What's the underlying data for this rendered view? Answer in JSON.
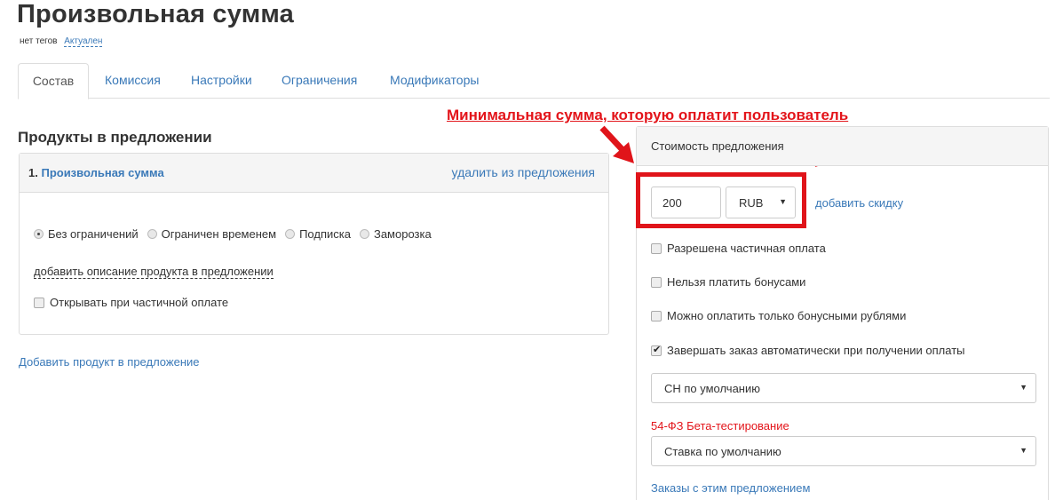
{
  "page": {
    "title": "Произвольная сумма",
    "tags": "нет тегов",
    "status": "Актуален"
  },
  "tabs": [
    "Состав",
    "Комиссия",
    "Настройки",
    "Ограничения",
    "Модификаторы"
  ],
  "annotation": "Минимальная сумма, которую оплатит пользователь",
  "products": {
    "title": "Продукты в предложении",
    "item": {
      "index": "1.",
      "name": "Произвольная сумма",
      "remove": "удалить из предложения",
      "limits": [
        {
          "label": "Без ограничений",
          "checked": true
        },
        {
          "label": "Ограничен временем",
          "checked": false
        },
        {
          "label": "Подписка",
          "checked": false
        },
        {
          "label": "Заморозка",
          "checked": false
        }
      ],
      "add_description": "добавить описание продукта в предложении",
      "open_partial": "Открывать при частичной оплате"
    },
    "add_product": "Добавить продукт в предложение"
  },
  "pricing": {
    "title": "Стоимость предложения",
    "amount": "200",
    "currency": "RUB",
    "add_discount": "добавить скидку",
    "options": [
      {
        "label": "Разрешена частичная оплата",
        "checked": false
      },
      {
        "label": "Нельзя платить бонусами",
        "checked": false
      },
      {
        "label": "Можно оплатить только бонусными рублями",
        "checked": false
      },
      {
        "label": "Завершать заказ автоматически при получении оплаты",
        "checked": true
      }
    ],
    "tax_system": "СН по умолчанию",
    "fz_label": "54-ФЗ Бета-тестирование",
    "vat_rate": "Ставка по умолчанию",
    "orders_link": "Заказы с этим предложением"
  },
  "colors": {
    "accent": "#3a79b8",
    "highlight": "#e0141a"
  }
}
